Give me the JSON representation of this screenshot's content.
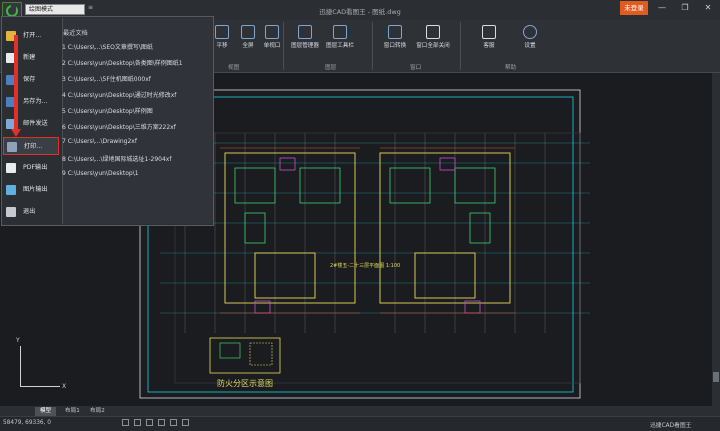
{
  "titlebar": {
    "app_icon": "app-logo-icon",
    "mode": "绘图模式",
    "title": "迅捷CAD看图王 - 图纸.dwg",
    "login": "未登录",
    "controls": [
      "—",
      "❐",
      "✕"
    ]
  },
  "ribbon": {
    "buttons": [
      {
        "label": "平移",
        "icon": "pan-icon"
      },
      {
        "label": "全屏",
        "icon": "fullscreen-icon"
      },
      {
        "label": "单视口",
        "icon": "single-viewport-icon"
      },
      {
        "label": "图层管理器",
        "icon": "layer-manager-icon"
      },
      {
        "label": "图层工具栏",
        "icon": "layer-toolbar-icon"
      },
      {
        "label": "窗口转换",
        "icon": "window-switch-icon"
      },
      {
        "label": "窗口全部关闭",
        "icon": "close-all-windows-icon"
      },
      {
        "label": "客服",
        "icon": "support-icon"
      },
      {
        "label": "设置",
        "icon": "settings-icon"
      }
    ],
    "groups": [
      "视图",
      "图层",
      "窗口",
      "帮助"
    ]
  },
  "file_menu": {
    "items": [
      {
        "label": "打开...",
        "icon": "open-folder-icon"
      },
      {
        "label": "新建",
        "icon": "new-file-icon"
      },
      {
        "label": "保存",
        "icon": "save-icon"
      },
      {
        "label": "另存为...",
        "icon": "save-as-icon"
      },
      {
        "label": "邮件发送",
        "icon": "mail-icon"
      },
      {
        "label": "打印...",
        "icon": "print-icon"
      },
      {
        "label": "PDF输出",
        "icon": "pdf-icon"
      },
      {
        "label": "图片输出",
        "icon": "image-export-icon"
      },
      {
        "label": "退出",
        "icon": "exit-icon"
      }
    ],
    "highlighted": "打印...",
    "recent_title": "最近文档",
    "recent": [
      "1 C:\\Users\\...\\SEO文章撰写\\图纸",
      "2 C:\\Users\\yun\\Desktop\\各类图\\样例图纸1",
      "3 C:\\Users\\...\\5F住机图纸000xf",
      "4 C:\\Users\\yun\\Desktop\\通过时光修改xf",
      "5 C:\\Users\\yun\\Desktop\\样例图",
      "6 C:\\Users\\yun\\Desktop\\三维方案222xf",
      "7 C:\\Users\\...\\Drawing2xf",
      "8 C:\\Users\\...\\绿地国际城选址1-2904xf",
      "9 C:\\Users\\yun\\Desktop\\1"
    ]
  },
  "drawing": {
    "caption_main": "2#楼五-二十三层平面图",
    "caption_scale": "1:100",
    "caption_fire": "防火分区示意图",
    "ucs_x": "X",
    "ucs_y": "Y"
  },
  "tabs": [
    "模型",
    "布局1",
    "布局2"
  ],
  "status": {
    "coords": "58479, 69336, 0",
    "brand": "迅捷CAD看图王"
  },
  "colors": {
    "accent": "#e05b1f",
    "highlight": "#e0302a",
    "cad_cyan": "#1fd3dc",
    "cad_yellow": "#e6dc5a",
    "cad_green": "#3cd26a",
    "cad_magenta": "#c84fd0"
  }
}
